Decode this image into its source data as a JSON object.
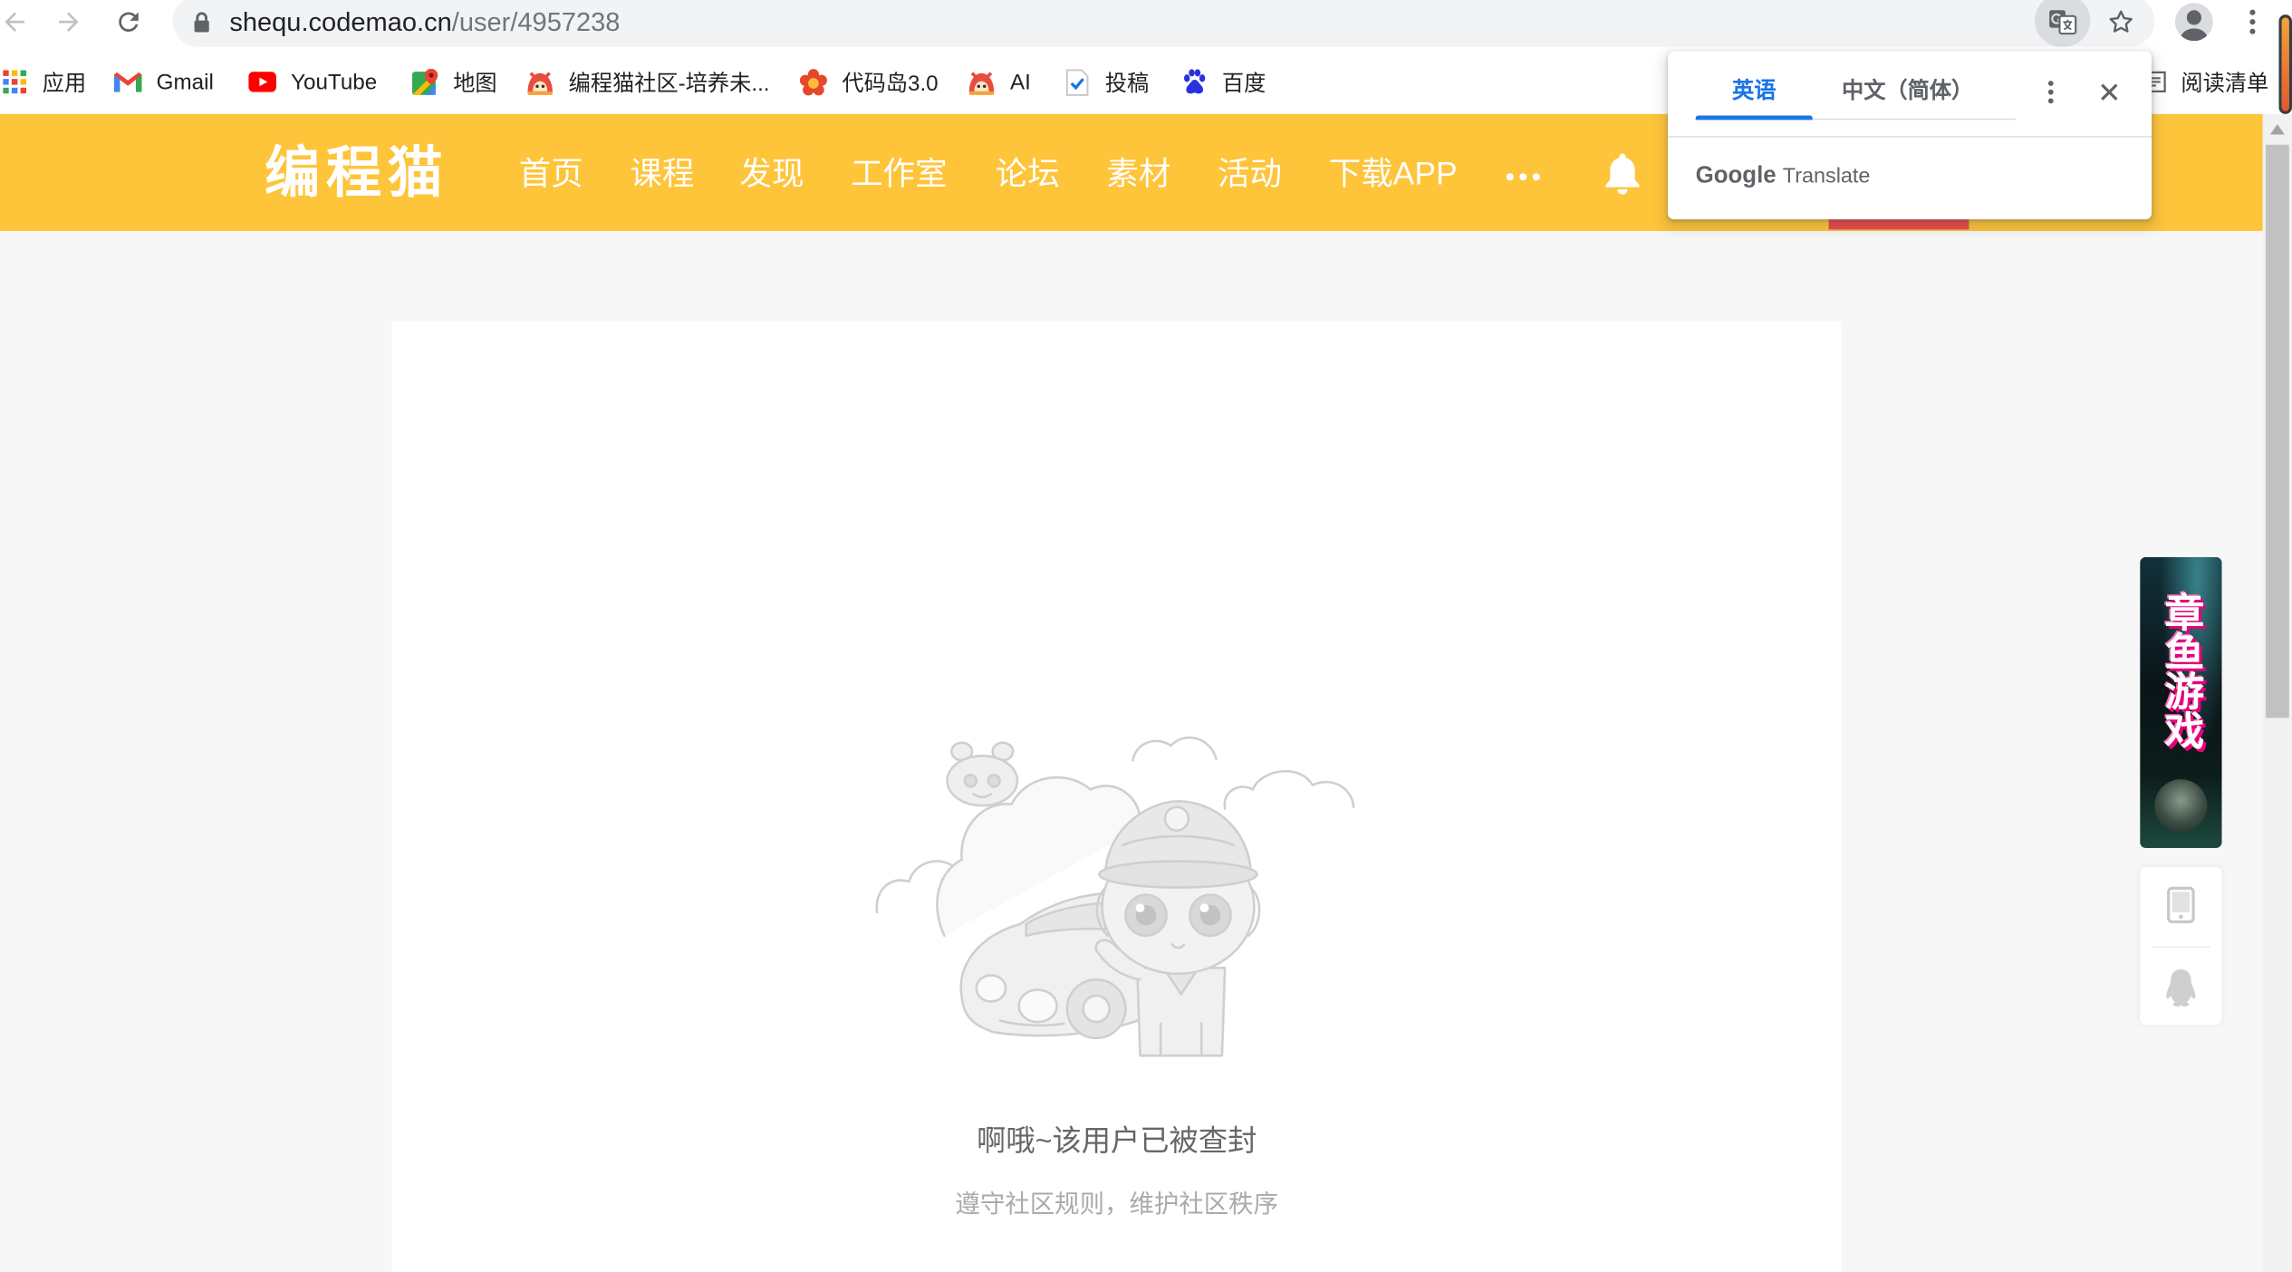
{
  "browser": {
    "url_host": "shequ.codemao.cn",
    "url_path": "/user/4957238",
    "icons": {
      "back": "back-arrow-icon",
      "forward": "forward-arrow-icon",
      "reload": "reload-icon",
      "lock": "lock-icon",
      "translate": "translate-icon",
      "bookmark_star": "star-icon",
      "profile": "profile-icon",
      "menu": "kebab-menu-icon"
    }
  },
  "bookmarks": {
    "items": [
      {
        "label": "应用",
        "icon": "apps-grid-icon"
      },
      {
        "label": "Gmail",
        "icon": "gmail-icon"
      },
      {
        "label": "YouTube",
        "icon": "youtube-icon"
      },
      {
        "label": "地图",
        "icon": "maps-icon"
      },
      {
        "label": "编程猫社区-培养未...",
        "icon": "codemao-icon"
      },
      {
        "label": "代码岛3.0",
        "icon": "code-island-icon"
      },
      {
        "label": "AI",
        "icon": "codemao-icon"
      },
      {
        "label": "投稿",
        "icon": "submit-doc-icon"
      },
      {
        "label": "百度",
        "icon": "baidu-paw-icon"
      }
    ],
    "reading_list": "阅读清单"
  },
  "site": {
    "logo": "编程猫",
    "nav": [
      "首页",
      "课程",
      "发现",
      "工作室",
      "论坛",
      "素材",
      "活动",
      "下载APP"
    ],
    "more_icon": "more-dots-icon",
    "notification_icon": "bell-icon",
    "colors": {
      "header": "#fec43a",
      "active_indicator": "#ea4a4a",
      "page_bg": "#f7f7f7",
      "card_bg": "#ffffff"
    }
  },
  "blocked_notice": {
    "title": "啊哦~该用户已被查封",
    "subtitle": "遵守社区规则，维护社区秩序",
    "illustration": "police-cat-illustration"
  },
  "translate_bubble": {
    "tabs": [
      {
        "label": "英语",
        "active": true
      },
      {
        "label": "中文（简体）",
        "active": false
      }
    ],
    "brand": "Google",
    "product": "Translate",
    "accent": "#1a73e8"
  },
  "side_banner": {
    "text": "章鱼游戏"
  },
  "side_tools": [
    {
      "icon": "mobile-phone-icon"
    },
    {
      "icon": "qq-penguin-icon"
    }
  ]
}
